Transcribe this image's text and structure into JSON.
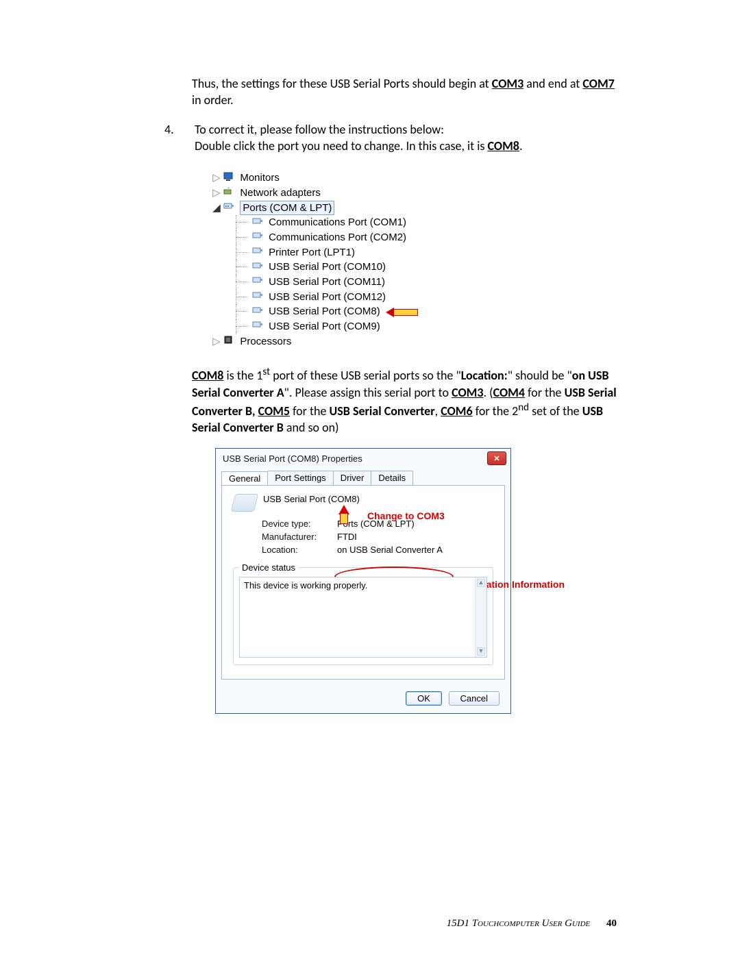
{
  "body": {
    "para1_pre": "Thus, the settings for these USB Serial Ports should begin at ",
    "para1_com3": "COM3",
    "para1_mid": " and end at ",
    "para1_com7": "COM7",
    "para1_post": " in order.",
    "step4_num": "4.",
    "step4_line1": "To correct it, please follow the instructions below:",
    "step4_line2_pre": "Double click the port you need to change. In this case, it is ",
    "step4_com8": "COM8",
    "step4_line2_post": ".",
    "para2": {
      "a": "COM8",
      "b": " is the 1",
      "sup1": "st",
      "c": " port of these USB serial ports so the \"",
      "loc": "Location:",
      "d": "\" should be \"",
      "conv": "on USB Serial Converter A",
      "e": "\". Please assign this serial port to ",
      "com3": "COM3",
      "f": ". (",
      "com4": "COM4",
      "g": " for the ",
      "convB": "USB Serial Converter B, ",
      "com5": "COM5",
      "h": " for the ",
      "usbser": "USB Serial Converter",
      "i": ", ",
      "com6": "COM6",
      "j": " for the 2",
      "sup2": "nd",
      "k": " set of the ",
      "convB2": "USB Serial Converter B",
      "l": " and so on)"
    }
  },
  "tree": {
    "monitors": "Monitors",
    "network": "Network adapters",
    "ports": "Ports (COM & LPT)",
    "children": [
      "Communications Port (COM1)",
      "Communications Port (COM2)",
      "Printer Port (LPT1)",
      "USB Serial Port (COM10)",
      "USB Serial Port (COM11)",
      "USB Serial Port (COM12)",
      "USB Serial Port (COM8)",
      "USB Serial Port (COM9)"
    ],
    "processors": "Processors"
  },
  "dialog": {
    "title": "USB Serial Port (COM8) Properties",
    "tabs": [
      "General",
      "Port Settings",
      "Driver",
      "Details"
    ],
    "device_name": "USB Serial Port (COM8)",
    "rows": {
      "type_lbl": "Device type:",
      "type_val": "Ports (COM & LPT)",
      "mfg_lbl": "Manufacturer:",
      "mfg_val": "FTDI",
      "loc_lbl": "Location:",
      "loc_val": "on USB Serial Converter A"
    },
    "status_legend": "Device status",
    "status_text": "This device is working properly.",
    "ok": "OK",
    "cancel": "Cancel",
    "annot_change": "Change to COM3",
    "annot_loc": "Location Information"
  },
  "footer": {
    "text": "15D1 Touchcomputer User Guide",
    "page": "40"
  }
}
